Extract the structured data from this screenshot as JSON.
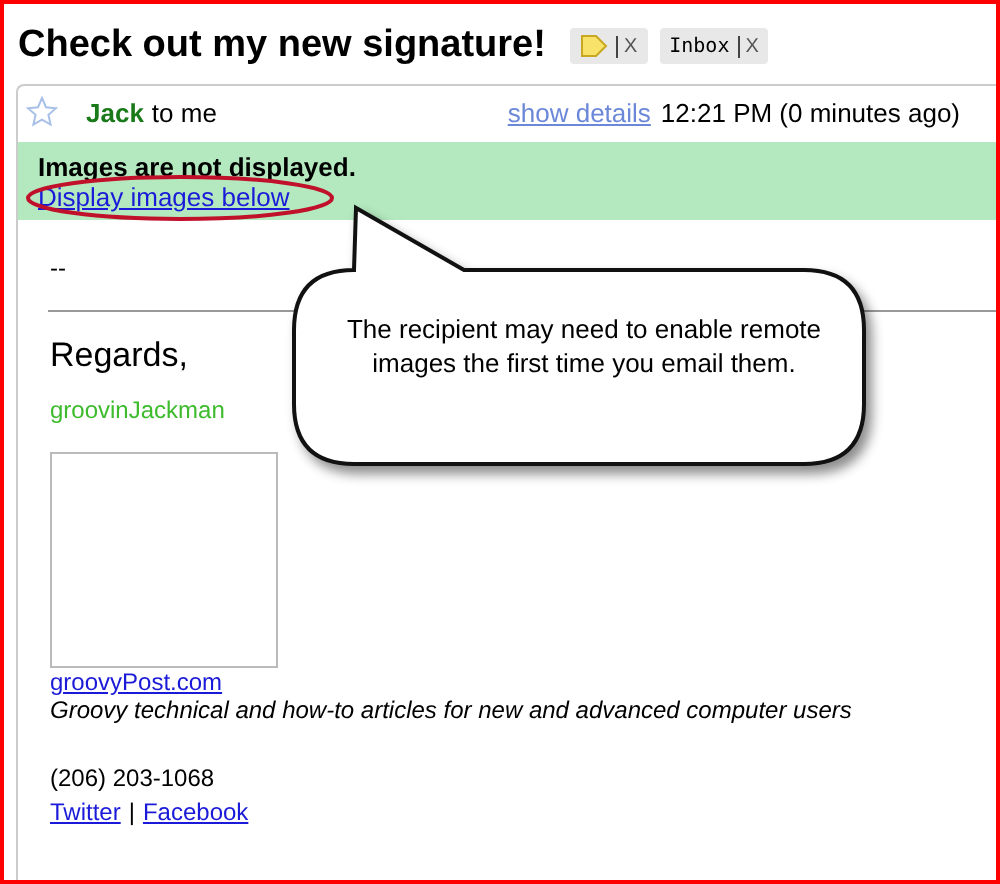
{
  "subject": "Check out my new signature!",
  "labels": [
    {
      "kind": "tag-icon",
      "color": "#f8e26a",
      "close": "X"
    },
    {
      "kind": "text",
      "text": "Inbox",
      "close": "X"
    }
  ],
  "message": {
    "starred": false,
    "sender": "Jack",
    "recipient": "to me",
    "details_link": "show details",
    "time": "12:21 PM (0 minutes ago)"
  },
  "banner": {
    "title": "Images are not displayed.",
    "link": "Display images below",
    "link_circled": true
  },
  "body": {
    "separator": "--",
    "greeting": "Regards,",
    "name": "groovinJackman",
    "site_link": "groovyPost.com",
    "tagline": "Groovy technical and how-to articles for new and advanced computer users",
    "phone": "(206) 203-1068",
    "social_links": [
      "Twitter",
      "Facebook"
    ],
    "link_separator": "|"
  },
  "callout": {
    "text": "The recipient may need to enable remote images the first time you email them."
  }
}
